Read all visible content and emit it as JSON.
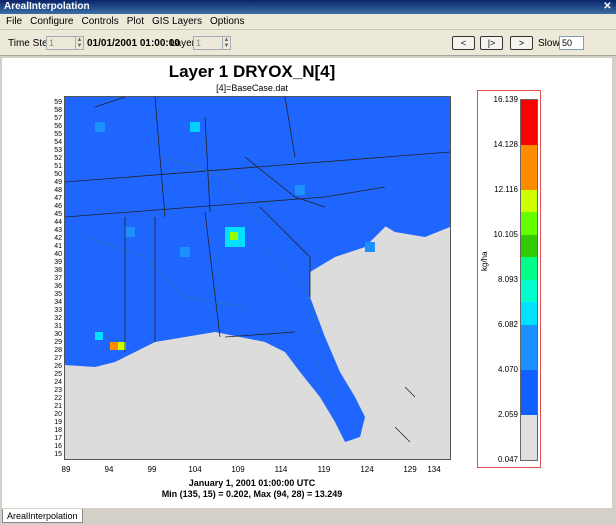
{
  "window": {
    "title": "ArealInterpolation",
    "close": "✕"
  },
  "menu": [
    "File",
    "Configure",
    "Controls",
    "Plot",
    "GIS Layers",
    "Options"
  ],
  "toolbar": {
    "timestep_label": "Time Step:",
    "timestep_value": "1",
    "datetime": "01/01/2001 01:00:00",
    "layer_label": "Layer:",
    "layer_value": "1",
    "prev": "<",
    "play": "|>",
    "next": ">",
    "slow_label": "Slow:",
    "slow_value": "50"
  },
  "plot": {
    "title": "Layer 1 DRYOX_N[4]",
    "subtitle": "[4]=BaseCase.dat",
    "footer_line1": "January 1, 2001 01:00:00 UTC",
    "footer_line2": "Min (135, 15) = 0.202, Max (94, 28) = 13.249",
    "x_ticks": [
      "89",
      "94",
      "99",
      "104",
      "109",
      "114",
      "119",
      "124",
      "129",
      "134"
    ],
    "y_ticks": [
      "59",
      "58",
      "57",
      "56",
      "55",
      "54",
      "53",
      "52",
      "51",
      "50",
      "49",
      "48",
      "47",
      "46",
      "45",
      "44",
      "43",
      "42",
      "41",
      "40",
      "39",
      "38",
      "37",
      "36",
      "35",
      "34",
      "33",
      "32",
      "31",
      "30",
      "29",
      "28",
      "27",
      "26",
      "25",
      "24",
      "23",
      "22",
      "21",
      "20",
      "19",
      "18",
      "17",
      "16",
      "15"
    ]
  },
  "legend": {
    "unit": "kg/ha",
    "ticks": [
      "16.139",
      "14.128",
      "12.116",
      "10.105",
      "8.093",
      "6.082",
      "4.070",
      "2.059",
      "0.047"
    ],
    "colors": [
      "#ff0000",
      "#ff8c00",
      "#ccff00",
      "#33cc00",
      "#00ffcc",
      "#00e0ff",
      "#1c90ff",
      "#1060ff",
      "#e0e0e0"
    ]
  },
  "tabs": [
    "ArealInterpolation"
  ]
}
